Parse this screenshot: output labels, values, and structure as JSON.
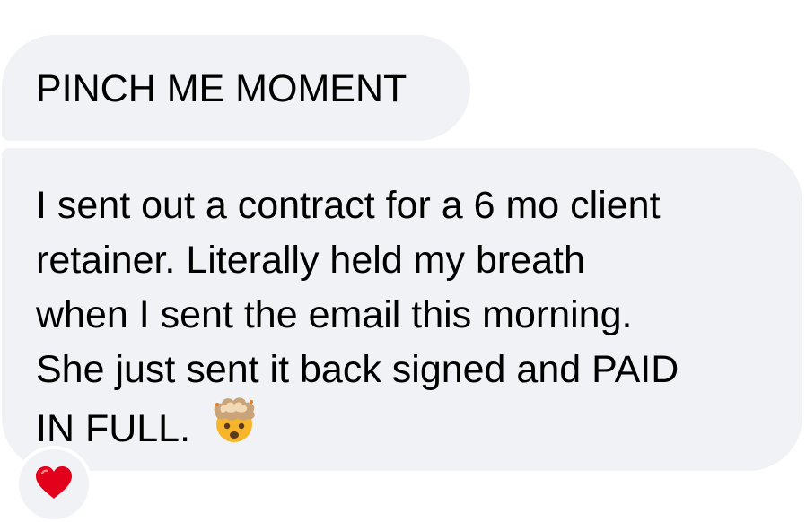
{
  "messages": [
    {
      "text": "PINCH ME MOMENT"
    },
    {
      "lines": [
        "I sent out a contract for a 6 mo client",
        "retainer. Literally held my breath",
        "when I sent the email this morning.",
        "She just sent it back signed and PAID",
        "IN FULL."
      ],
      "emoji": "exploding-head-icon"
    }
  ],
  "reaction": {
    "icon": "red-heart-icon",
    "color": "#e3001b"
  },
  "colors": {
    "bubble": "#f1f2f5",
    "text": "#000000"
  }
}
